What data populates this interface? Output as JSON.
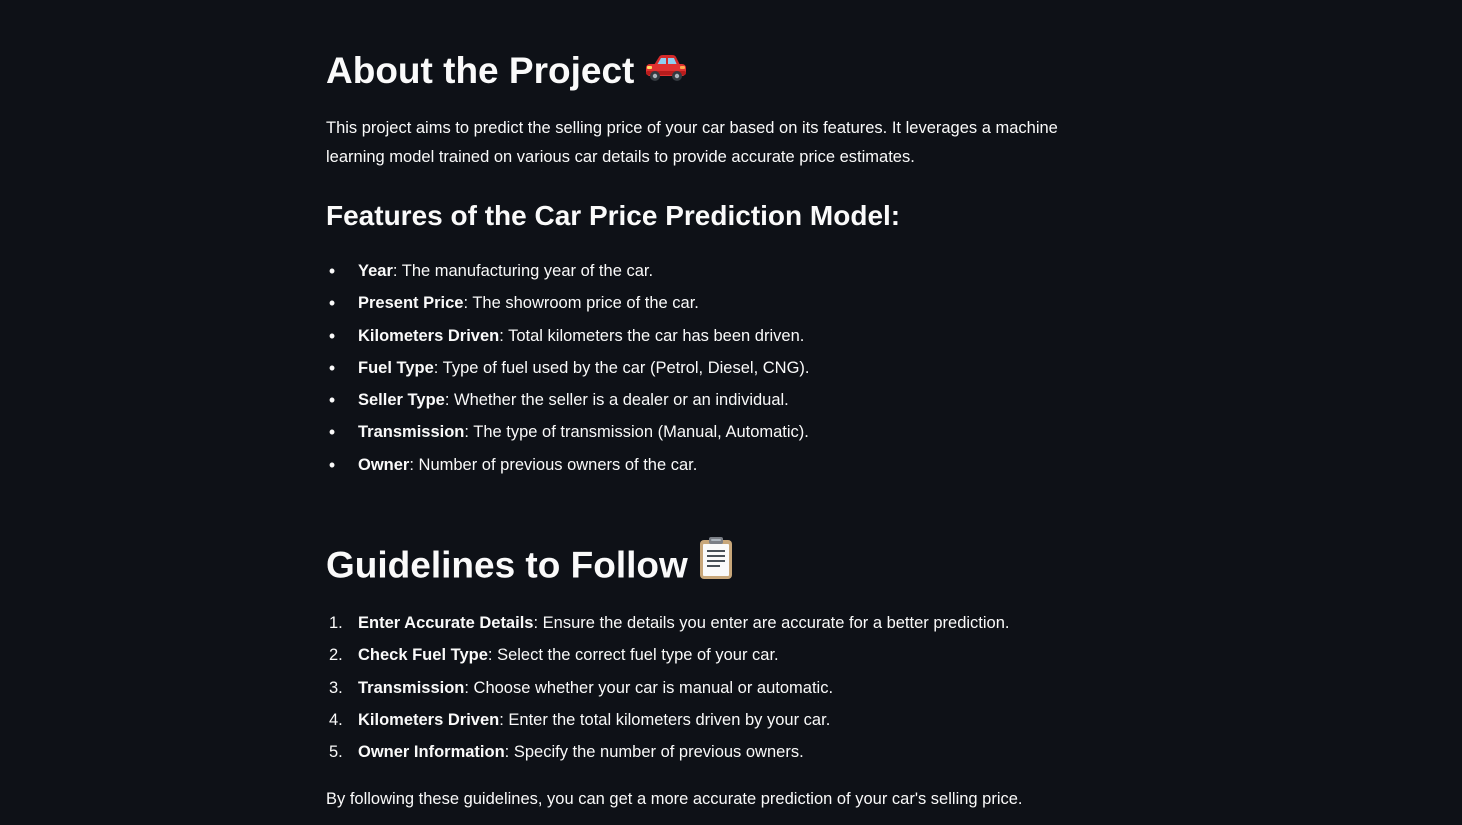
{
  "about": {
    "title": "About the Project",
    "title_icon": "car-icon",
    "intro": "This project aims to predict the selling price of your car based on its features. It leverages a machine learning model trained on various car details to provide accurate price estimates."
  },
  "features": {
    "title": "Features of the Car Price Prediction Model:",
    "items": [
      {
        "term": "Year",
        "desc": ": The manufacturing year of the car."
      },
      {
        "term": "Present Price",
        "desc": ": The showroom price of the car."
      },
      {
        "term": "Kilometers Driven",
        "desc": ": Total kilometers the car has been driven."
      },
      {
        "term": "Fuel Type",
        "desc": ": Type of fuel used by the car (Petrol, Diesel, CNG)."
      },
      {
        "term": "Seller Type",
        "desc": ": Whether the seller is a dealer or an individual."
      },
      {
        "term": "Transmission",
        "desc": ": The type of transmission (Manual, Automatic)."
      },
      {
        "term": "Owner",
        "desc": ": Number of previous owners of the car."
      }
    ]
  },
  "guidelines": {
    "title": "Guidelines to Follow",
    "title_icon": "clipboard-icon",
    "items": [
      {
        "num": "1.",
        "term": "Enter Accurate Details",
        "desc": ": Ensure the details you enter are accurate for a better prediction."
      },
      {
        "num": "2.",
        "term": "Check Fuel Type",
        "desc": ": Select the correct fuel type of your car."
      },
      {
        "num": "3.",
        "term": "Transmission",
        "desc": ": Choose whether your car is manual or automatic."
      },
      {
        "num": "4.",
        "term": "Kilometers Driven",
        "desc": ": Enter the total kilometers driven by your car."
      },
      {
        "num": "5.",
        "term": "Owner Information",
        "desc": ": Specify the number of previous owners."
      }
    ],
    "closing": "By following these guidelines, you can get a more accurate prediction of your car's selling price."
  },
  "colors": {
    "background": "#0e1117",
    "text": "#fafafa"
  }
}
